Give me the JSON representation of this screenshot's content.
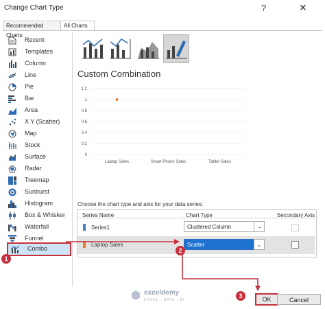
{
  "dialog": {
    "title": "Change Chart Type",
    "help": "?",
    "close": "✕"
  },
  "tabs": [
    {
      "label": "Recommended Charts"
    },
    {
      "label": "All Charts"
    }
  ],
  "sidebar": {
    "items": [
      {
        "label": "Recent",
        "icon": "recent-icon"
      },
      {
        "label": "Templates",
        "icon": "templates-icon"
      },
      {
        "label": "Column",
        "icon": "column-icon"
      },
      {
        "label": "Line",
        "icon": "line-icon"
      },
      {
        "label": "Pie",
        "icon": "pie-icon"
      },
      {
        "label": "Bar",
        "icon": "bar-icon"
      },
      {
        "label": "Area",
        "icon": "area-icon"
      },
      {
        "label": "X Y (Scatter)",
        "icon": "scatter-icon"
      },
      {
        "label": "Map",
        "icon": "map-icon"
      },
      {
        "label": "Stock",
        "icon": "stock-icon"
      },
      {
        "label": "Surface",
        "icon": "surface-icon"
      },
      {
        "label": "Radar",
        "icon": "radar-icon"
      },
      {
        "label": "Treemap",
        "icon": "treemap-icon"
      },
      {
        "label": "Sunburst",
        "icon": "sunburst-icon"
      },
      {
        "label": "Histogram",
        "icon": "histogram-icon"
      },
      {
        "label": "Box & Whisker",
        "icon": "box-whisker-icon"
      },
      {
        "label": "Waterfall",
        "icon": "waterfall-icon"
      },
      {
        "label": "Funnel",
        "icon": "funnel-icon"
      },
      {
        "label": "Combo",
        "icon": "combo-icon"
      }
    ],
    "selected": "Combo"
  },
  "main": {
    "custom_title": "Custom Combination",
    "series_prompt": "Choose the chart type and axis for your data series:",
    "headers": {
      "series_name": "Series Name",
      "chart_type": "Chart Type",
      "secondary_axis": "Secondary Axis"
    },
    "rows": [
      {
        "name": "Series1",
        "color": "#4a7fc1",
        "chart_type": "Clustered Column",
        "secondary": false
      },
      {
        "name": "Laptop Sales",
        "color": "#ed7d31",
        "chart_type": "Scatter",
        "secondary": false
      }
    ]
  },
  "chart_data": {
    "type": "scatter",
    "categories": [
      "Laptop Sales",
      "Smart Phone Sales",
      "Tablet Sales"
    ],
    "y_ticks": [
      "1.2",
      "1",
      "0.8",
      "0.6",
      "0.4",
      "0.2",
      "0"
    ],
    "ylim": [
      0,
      1.2
    ],
    "series": [
      {
        "values": [
          1
        ],
        "color": "#ed7d31"
      }
    ],
    "grid": true
  },
  "buttons": {
    "ok": "OK",
    "cancel": "Cancel"
  },
  "annotations": {
    "badge1": "1",
    "badge2": "2",
    "badge3": "3",
    "accent": "#c6303d"
  },
  "watermark": {
    "name": "exceldemy",
    "tagline": "EXCEL · DATA · BI"
  }
}
